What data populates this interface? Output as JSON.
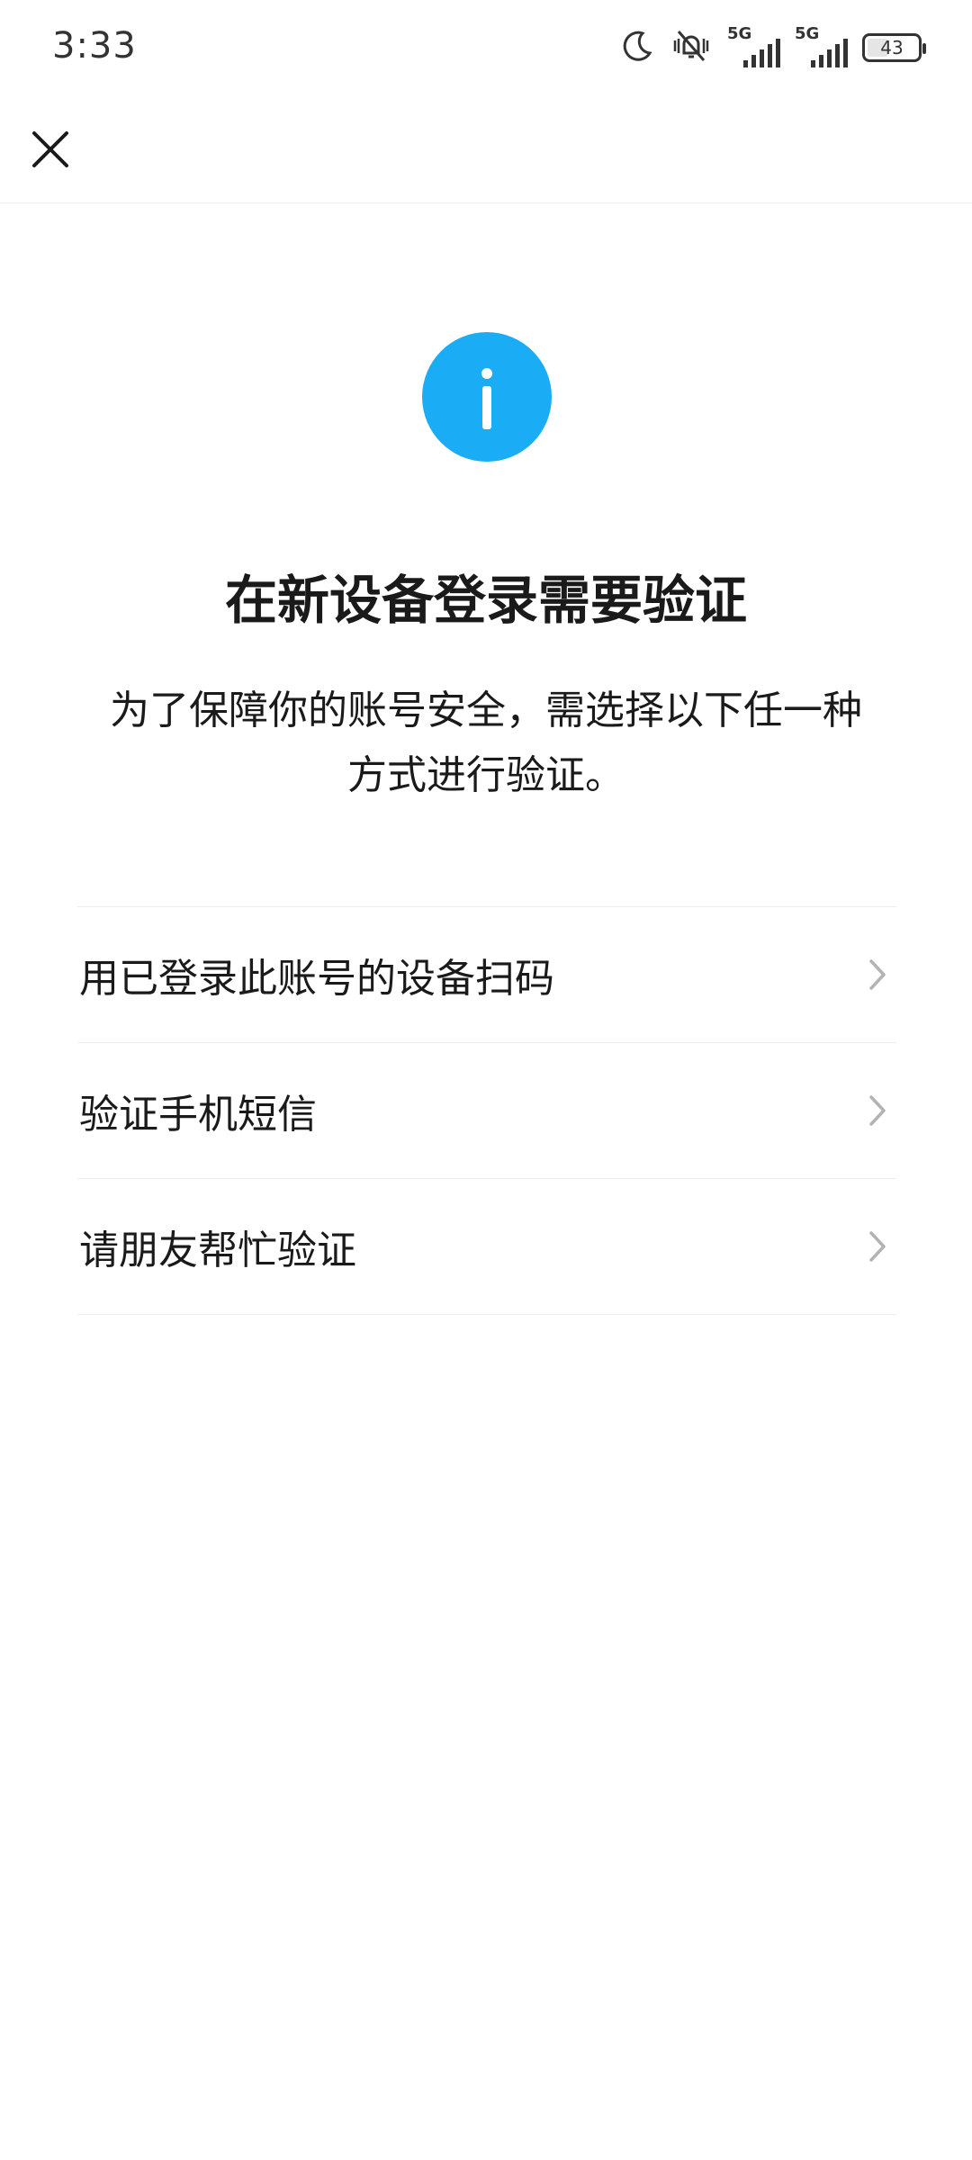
{
  "status_bar": {
    "time": "3:33",
    "network_1": "5G",
    "network_2": "5G",
    "battery": "43",
    "battery_level_percent": 43
  },
  "nav": {
    "close_icon": "close-icon"
  },
  "content": {
    "icon": "info-icon",
    "icon_symbol": "i",
    "title": "在新设备登录需要验证",
    "description_line_1": "为了保障你的账号安全，需选择以下任一种",
    "description_line_2": "方式进行验证。"
  },
  "options": [
    {
      "label": "用已登录此账号的设备扫码"
    },
    {
      "label": "验证手机短信"
    },
    {
      "label": "请朋友帮忙验证"
    }
  ],
  "colors": {
    "accent": "#1aadf5",
    "text": "#1a1a1a",
    "divider": "#ececec",
    "chevron": "#b3b3b3"
  }
}
